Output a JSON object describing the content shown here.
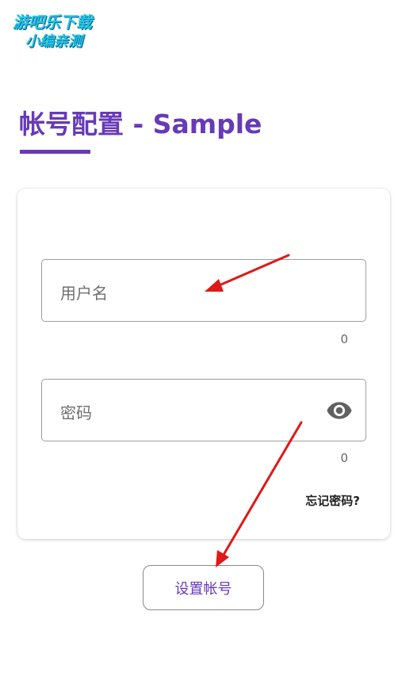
{
  "watermark": {
    "line1": "游吧乐下载",
    "line2": "小编亲测"
  },
  "page": {
    "title": "帐号配置 - Sample"
  },
  "form": {
    "username_placeholder": "用户名",
    "username_counter": "0",
    "password_placeholder": "密码",
    "password_counter": "0",
    "forgot_label": "忘记密码?"
  },
  "actions": {
    "setup_label": "设置帐号"
  },
  "colors": {
    "accent": "#673ab7",
    "annotation_arrow": "#e01818",
    "watermark": "#22c7e6"
  },
  "icons": {
    "password_toggle": "eye-icon"
  }
}
